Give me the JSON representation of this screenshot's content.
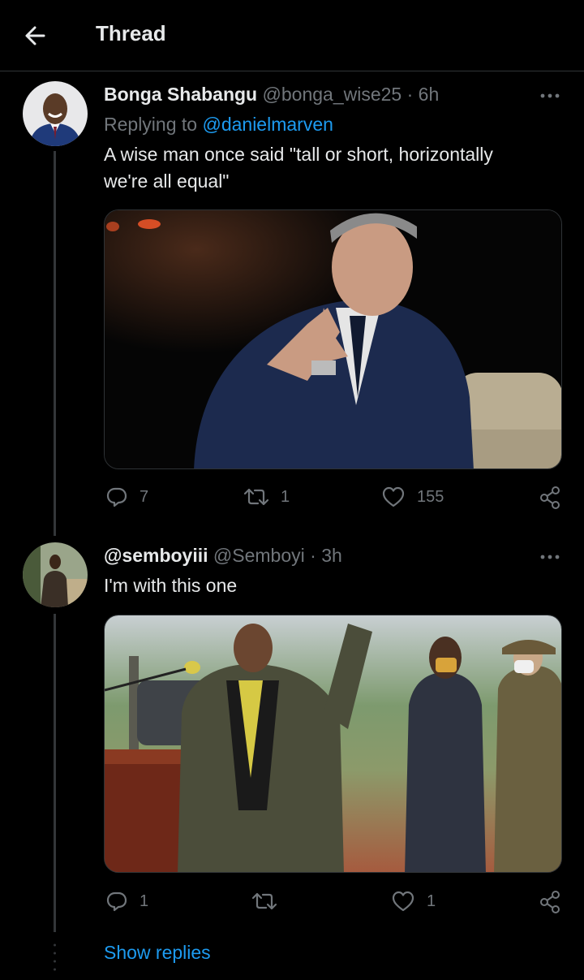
{
  "header": {
    "title": "Thread"
  },
  "tweets": [
    {
      "display_name": "Bonga Shabangu",
      "handle": "@bonga_wise25",
      "sep": "·",
      "time": "6h",
      "replying_label": "Replying to",
      "replying_to": "@danielmarven",
      "text_line1": "A wise man once said \"tall or short, horizontally",
      "text_line2": "we're all equal\"",
      "counts": {
        "replies": "7",
        "retweets": "1",
        "likes": "155"
      }
    },
    {
      "display_name": "@semboyiii",
      "handle": "@Semboyi",
      "sep": "·",
      "time": "3h",
      "text_line1": "I'm with this one",
      "counts": {
        "replies": "1",
        "retweets": "",
        "likes": "1"
      }
    }
  ],
  "footer": {
    "show_replies": "Show replies"
  },
  "colors": {
    "accent": "#1d9bf0",
    "muted": "#71767b",
    "background": "#000000"
  }
}
